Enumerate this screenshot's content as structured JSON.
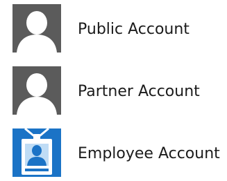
{
  "accounts": [
    {
      "label": "Public Account",
      "icon": "person-icon",
      "tile_color": "#5b5b5b"
    },
    {
      "label": "Partner Account",
      "icon": "person-icon",
      "tile_color": "#5b5b5b"
    },
    {
      "label": "Employee Account",
      "icon": "employee-badge-icon",
      "tile_color": "#1b73c6"
    }
  ]
}
